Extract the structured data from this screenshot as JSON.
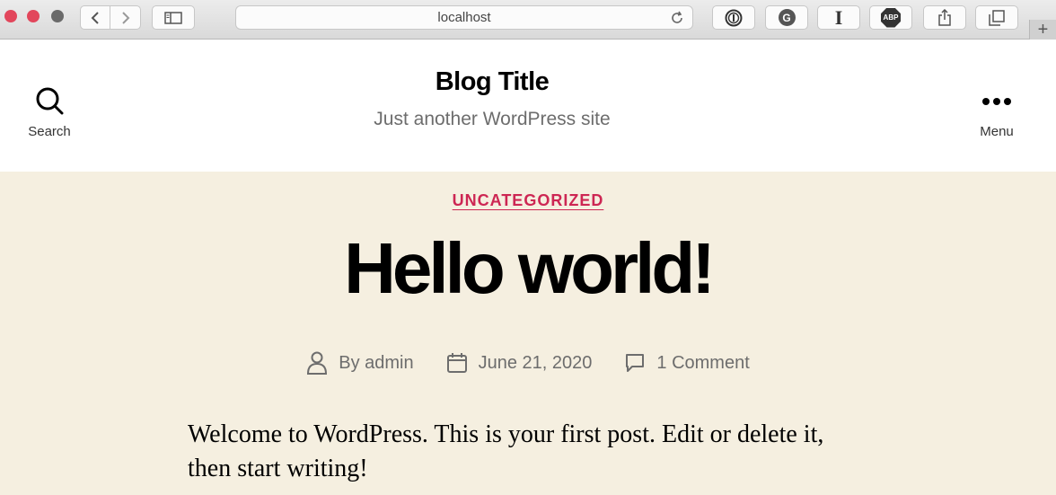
{
  "browser": {
    "url": "localhost",
    "extensions": [
      "1password-icon",
      "grammarly-icon",
      "instapaper-icon",
      "adblock-plus-icon"
    ],
    "adblock_label": "ABP",
    "instapaper_label": "I",
    "grammarly_label": "G",
    "newtab_label": "+"
  },
  "header": {
    "title": "Blog Title",
    "tagline": "Just another WordPress site",
    "search_label": "Search",
    "menu_label": "Menu"
  },
  "post": {
    "category": "UNCATEGORIZED",
    "title": "Hello world!",
    "author": "By admin",
    "date": "June 21, 2020",
    "comments": "1 Comment",
    "excerpt": "Welcome to WordPress. This is your first post. Edit or delete it, then start writing!"
  },
  "colors": {
    "accent": "#cd2653",
    "content_bg": "#f5efe0",
    "meta_text": "#6d6d6d"
  }
}
